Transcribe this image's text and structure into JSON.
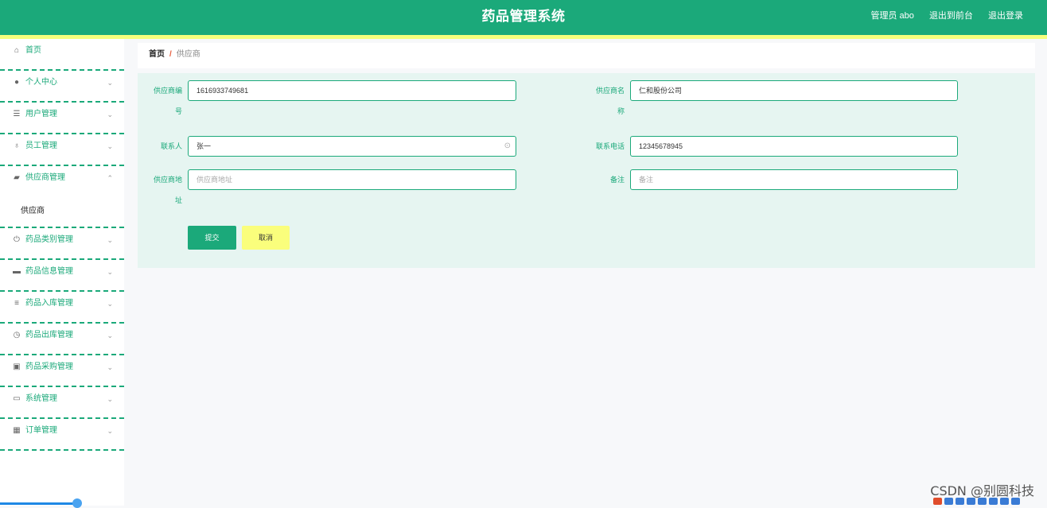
{
  "header": {
    "title": "药品管理系统",
    "admin": "管理员 abo",
    "back_front": "退出到前台",
    "logout": "退出登录"
  },
  "sidebar": {
    "items": [
      {
        "icon": "home-icon",
        "glyph": "⌂",
        "label": "首页",
        "chevron": ""
      },
      {
        "icon": "user-icon",
        "glyph": "●",
        "label": "个人中心",
        "chevron": "⌄"
      },
      {
        "icon": "list-icon",
        "glyph": "☰",
        "label": "用户管理",
        "chevron": "⌄"
      },
      {
        "icon": "microphone-icon",
        "glyph": "♁",
        "label": "员工管理",
        "chevron": "⌄"
      },
      {
        "icon": "supplier-icon",
        "glyph": "▰",
        "label": "供应商管理",
        "chevron": "⌃"
      },
      {
        "icon": "power-icon",
        "glyph": "⏻",
        "label": "药品类别管理",
        "chevron": "⌄"
      },
      {
        "icon": "briefcase-icon",
        "glyph": "▬",
        "label": "药品信息管理",
        "chevron": "⌄"
      },
      {
        "icon": "menu-icon",
        "glyph": "≡",
        "label": "药品入库管理",
        "chevron": "⌄"
      },
      {
        "icon": "clock-icon",
        "glyph": "◷",
        "label": "药品出库管理",
        "chevron": "⌄"
      },
      {
        "icon": "clipboard-icon",
        "glyph": "▣",
        "label": "药品采购管理",
        "chevron": "⌄"
      },
      {
        "icon": "chat-icon",
        "glyph": "▭",
        "label": "系统管理",
        "chevron": "⌄"
      },
      {
        "icon": "grid-icon",
        "glyph": "▦",
        "label": "订单管理",
        "chevron": "⌄"
      }
    ],
    "sub_item": "供应商"
  },
  "breadcrumb": {
    "home": "首页",
    "separator": "/",
    "current": "供应商"
  },
  "form": {
    "supplier_no": {
      "label1": "供应商编",
      "label2": "号",
      "value": "1616933749681"
    },
    "supplier_name": {
      "label1": "供应商名",
      "label2": "称",
      "value": "仁和股份公司"
    },
    "contact": {
      "label": "联系人",
      "value": "张一"
    },
    "phone": {
      "label": "联系电话",
      "value": "12345678945"
    },
    "address": {
      "label1": "供应商地",
      "label2": "址",
      "placeholder": "供应商地址"
    },
    "remark": {
      "label": "备注",
      "placeholder": "备注"
    },
    "submit": "提交",
    "cancel": "取消"
  },
  "watermark": "CSDN @别圆科技",
  "colors": {
    "primary": "#1ba97a",
    "accent_yellow": "#f5ff7d",
    "panel_bg": "#e6f5f1"
  }
}
